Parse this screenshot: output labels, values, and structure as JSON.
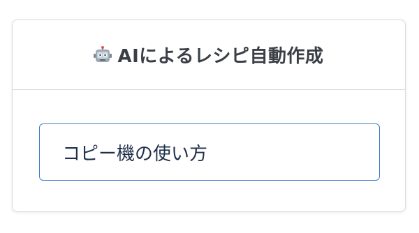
{
  "card": {
    "icon": "robot-icon",
    "title": "AIによるレシピ自動作成",
    "input_value": "コピー機の使い方"
  },
  "colors": {
    "title_text": "#3a3f46",
    "input_border": "#3f7ccb",
    "input_text": "#1f2f4a",
    "divider": "#d3d8e2"
  }
}
